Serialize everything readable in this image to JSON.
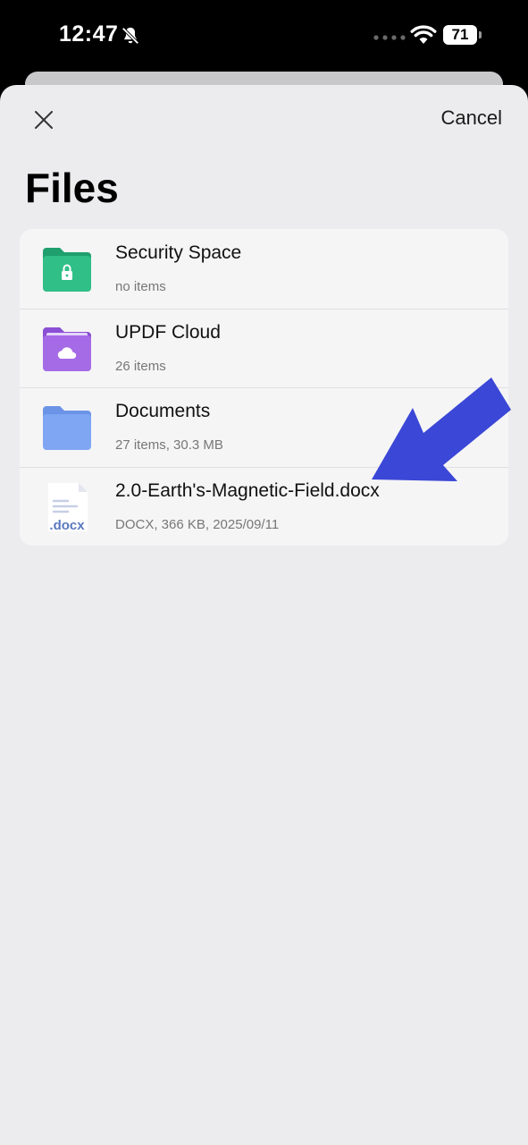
{
  "status_bar": {
    "time": "12:47",
    "battery": "71",
    "icons": [
      "bell-slash-icon",
      "signal-dots-icon",
      "wifi-icon",
      "battery-icon"
    ]
  },
  "header": {
    "close_icon": "close-icon",
    "cancel_label": "Cancel",
    "title": "Files"
  },
  "files": {
    "items": [
      {
        "title": "Security Space",
        "subtitle": "no items",
        "icon": "lock-folder-icon",
        "color": "#2fbf87"
      },
      {
        "title": "UPDF Cloud",
        "subtitle": "26 items",
        "icon": "cloud-folder-icon",
        "color": "#a56be6"
      },
      {
        "title": "Documents",
        "subtitle": "27 items, 30.3 MB",
        "icon": "folder-icon",
        "color": "#7fa6f2"
      },
      {
        "title": "2.0-Earth's-Magnetic-Field.docx",
        "subtitle": "DOCX, 366 KB, 2025/09/11",
        "icon": "docx-file-icon",
        "icon_label": ".docx"
      }
    ]
  },
  "annotation": {
    "icon": "arrow-icon",
    "color": "#3b47d6"
  }
}
